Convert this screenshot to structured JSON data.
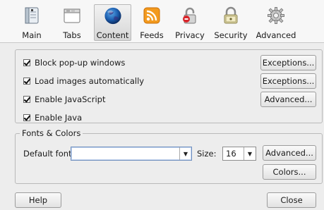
{
  "toolbar": {
    "items": [
      {
        "label": "Main",
        "icon": "main-switch-icon"
      },
      {
        "label": "Tabs",
        "icon": "tabs-window-icon"
      },
      {
        "label": "Content",
        "icon": "globe-icon"
      },
      {
        "label": "Feeds",
        "icon": "rss-icon"
      },
      {
        "label": "Privacy",
        "icon": "lock-icon"
      },
      {
        "label": "Security",
        "icon": "safe-lock-icon"
      },
      {
        "label": "Advanced",
        "icon": "gear-icon"
      }
    ],
    "selected": "Content"
  },
  "content": {
    "block_popups": "Block pop-up windows",
    "load_images": "Load images automatically",
    "enable_js": "Enable JavaScript",
    "enable_java": "Enable Java",
    "block_popups_checked": true,
    "load_images_checked": true,
    "enable_js_checked": true,
    "enable_java_checked": true,
    "exceptions_popup_btn": "Exceptions...",
    "exceptions_images_btn": "Exceptions...",
    "advanced_js_btn": "Advanced..."
  },
  "fonts": {
    "group_title": "Fonts & Colors",
    "default_font_label": "Default font:",
    "default_font_value": "",
    "size_label": "Size:",
    "size_value": "16",
    "advanced_btn": "Advanced...",
    "colors_btn": "Colors..."
  },
  "footer": {
    "help_btn": "Help",
    "close_btn": "Close"
  },
  "colors": {
    "window_bg": "#ededed",
    "toolbar_bg": "#f7f7f7",
    "selected_item_bg": "#d6d6d6"
  }
}
